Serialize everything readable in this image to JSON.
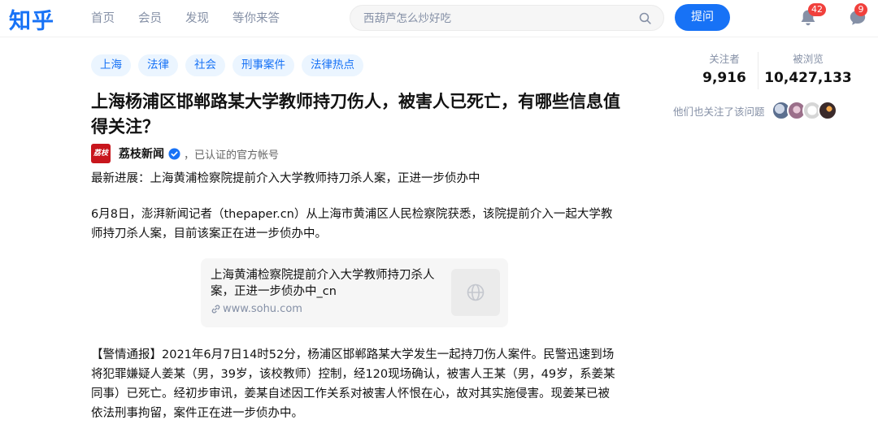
{
  "header": {
    "logo": "知乎",
    "nav": [
      "首页",
      "会员",
      "发现",
      "等你来答"
    ],
    "search_placeholder": "西葫芦怎么炒好吃",
    "ask_label": "提问",
    "notifications_count": "42",
    "messages_count": "9"
  },
  "question": {
    "topics": [
      "上海",
      "法律",
      "社会",
      "刑事案件",
      "法律热点"
    ],
    "title": "上海杨浦区邯郸路某大学教师持刀伤人，被害人已死亡，有哪些信息值得关注？"
  },
  "author": {
    "avatar_text": "荔枝",
    "name": "荔枝新闻",
    "description": "，已认证的官方帐号"
  },
  "content": {
    "p1": "最新进展：上海黄浦检察院提前介入大学教师持刀杀人案，正进一步侦办中",
    "p2": "6月8日，澎湃新闻记者（thepaper.cn）从上海市黄浦区人民检察院获悉，该院提前介入一起大学教师持刀杀人案，目前该案正在进一步侦办中。",
    "link_card": {
      "title": "上海黄浦检察院提前介入大学教师持刀杀人案，正进一步侦办中_cn",
      "url": "www.sohu.com"
    },
    "p3": "【警情通报】2021年6月7日14时52分，杨浦区邯郸路某大学发生一起持刀伤人案件。民警迅速到场将犯罪嫌疑人姜某（男，39岁，该校教师）控制，经120现场确认，被害人王某（男，49岁，系姜某同事）已死亡。经初步审讯，姜某自述因工作关系对被害人怀恨在心，故对其实施侵害。现姜某已被依法刑事拘留，案件正在进一步侦办中。"
  },
  "sidebar": {
    "followers_label": "关注者",
    "followers_value": "9,916",
    "views_label": "被浏览",
    "views_value": "10,427,133",
    "also_following": "他们也关注了该问题"
  },
  "colors": {
    "brand": "#1772f6",
    "badge": "#f1403c",
    "muted": "#8590a6"
  }
}
